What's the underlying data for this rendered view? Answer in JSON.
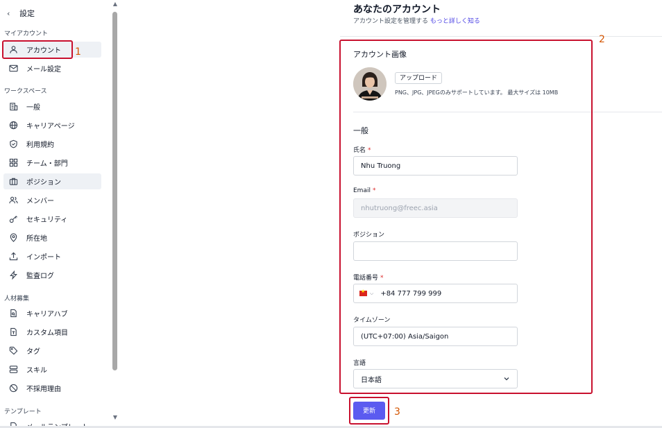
{
  "sidebar": {
    "back_label": "設定",
    "sections": {
      "my_account": "マイアカウント",
      "workspace": "ワークスペース",
      "recruiting": "人材募集",
      "templates": "テンプレート"
    },
    "items": {
      "account": "アカウント",
      "email_settings": "メール設定",
      "general": "一般",
      "career_page": "キャリアページ",
      "terms": "利用規約",
      "teams": "チーム・部門",
      "positions": "ポジション",
      "members": "メンバー",
      "security": "セキュリティ",
      "location": "所在地",
      "import": "インポート",
      "audit_log": "監査ログ",
      "career_hub": "キャリアハブ",
      "custom_fields": "カスタム項目",
      "tags": "タグ",
      "skills": "スキル",
      "rejection_reasons": "不採用理由",
      "template_item": "メールテンプレート"
    }
  },
  "header": {
    "title": "あなたのアカウント",
    "subtitle": "アカウント設定を管理する",
    "learn_more": "もっと詳しく知る"
  },
  "account_image": {
    "heading": "アカウント画像",
    "upload_label": "アップロード",
    "hint": "PNG、JPG、JPEGのみサポートしています。 最大サイズは 10MB"
  },
  "general": {
    "heading": "一般",
    "name": {
      "label": "氏名",
      "value": "Nhu Truong"
    },
    "email": {
      "label": "Email",
      "value": "nhutruong@freec.asia"
    },
    "position": {
      "label": "ポジション",
      "value": ""
    },
    "phone": {
      "label": "電話番号",
      "value": "+84 777 799 999"
    },
    "timezone": {
      "label": "タイムゾーン",
      "value": "(UTC+07:00) Asia/Saigon"
    },
    "language": {
      "label": "言語",
      "value": "日本語"
    }
  },
  "save_label": "更新",
  "annotations": [
    "1",
    "2",
    "3"
  ],
  "colors": {
    "accent": "#5b5bf0",
    "annotation": "#c8102e",
    "annotation_number": "#d45500",
    "link": "#4f46e5"
  }
}
